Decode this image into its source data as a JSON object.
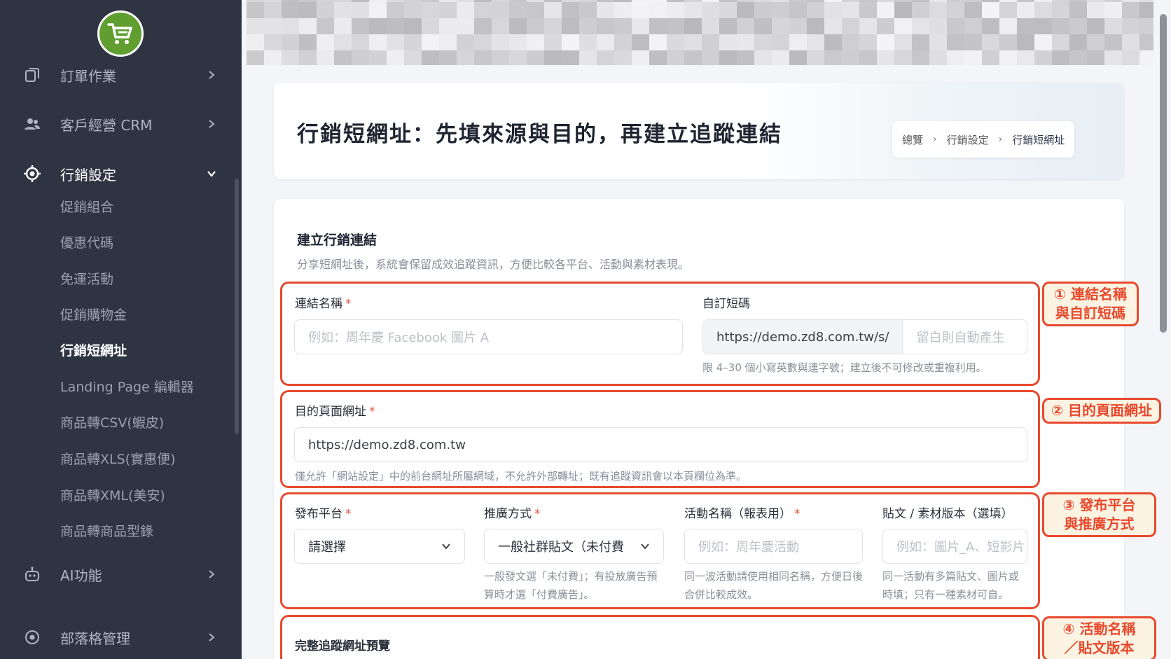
{
  "sidebar": {
    "logo_icon": "shopping-cart-icon",
    "items": [
      {
        "label": "訂單作業",
        "icon": "clipboard-icon"
      },
      {
        "label": "客戶經營 CRM",
        "icon": "users-icon"
      },
      {
        "label": "行銷設定",
        "icon": "target-icon"
      },
      {
        "label": "AI功能",
        "icon": "robot-icon"
      },
      {
        "label": "部落格管理",
        "icon": "blog-icon"
      }
    ],
    "sub_items": [
      "促銷組合",
      "優惠代碼",
      "免運活動",
      "促銷購物金",
      "行銷短網址",
      "Landing Page 編輯器",
      "商品轉CSV(蝦皮)",
      "商品轉XLS(實惠便)",
      "商品轉XML(美安)",
      "商品轉商品型錄"
    ]
  },
  "header": {
    "title": "行銷短網址：先填來源與目的，再建立追蹤連結",
    "breadcrumb": [
      "總覽",
      "行銷設定",
      "行銷短網址"
    ]
  },
  "form": {
    "section_title": "建立行銷連結",
    "section_desc": "分享短網址後，系統會保留成效追蹤資訊，方便比較各平台、活動與素材表現。",
    "required_mark": "*",
    "link_name": {
      "label": "連結名稱",
      "placeholder": "例如：周年慶 Facebook 圖片 A"
    },
    "custom_code": {
      "label": "自訂短碼",
      "prefix": "https://demo.zd8.com.tw/s/",
      "placeholder": "留白則自動產生",
      "help": "限 4–30 個小寫英數與連字號；建立後不可修改或重複利用。"
    },
    "target_url": {
      "label": "目的頁面網址",
      "value": "https://demo.zd8.com.tw",
      "help": "僅允許「網站設定」中的前台網址所屬網域，不允許外部轉址；既有追蹤資訊會以本頁欄位為準。"
    },
    "platform": {
      "label": "發布平台",
      "value": "請選擇"
    },
    "promo_type": {
      "label": "推廣方式",
      "value": "一般社群貼文（未付費",
      "help": "一般發文選「未付費」；有投放廣告預算時才選「付費廣告」。"
    },
    "campaign": {
      "label": "活動名稱（報表用）",
      "placeholder": "例如：周年慶活動",
      "help": "同一波活動請使用相同名稱，方便日後合併比較成效。"
    },
    "creative": {
      "label": "貼文 / 素材版本（選填）",
      "placeholder": "例如：圖片_A、短影片",
      "help": "同一活動有多篇貼文、圖片或時填；只有一種素材可自。"
    },
    "preview_title": "完整追蹤網址預覽"
  },
  "annotations": [
    "① 連結名稱\n與自訂短碼",
    "② 目的頁面網址",
    "③ 發布平台\n與推廣方式",
    "④ 活動名稱\n／貼文版本"
  ],
  "colors": {
    "sidebar_bg": "#2e3442",
    "annotation_red": "#e8492e",
    "annotation_fill": "#fdf3e2",
    "logo_green": "#5f9e2f"
  }
}
